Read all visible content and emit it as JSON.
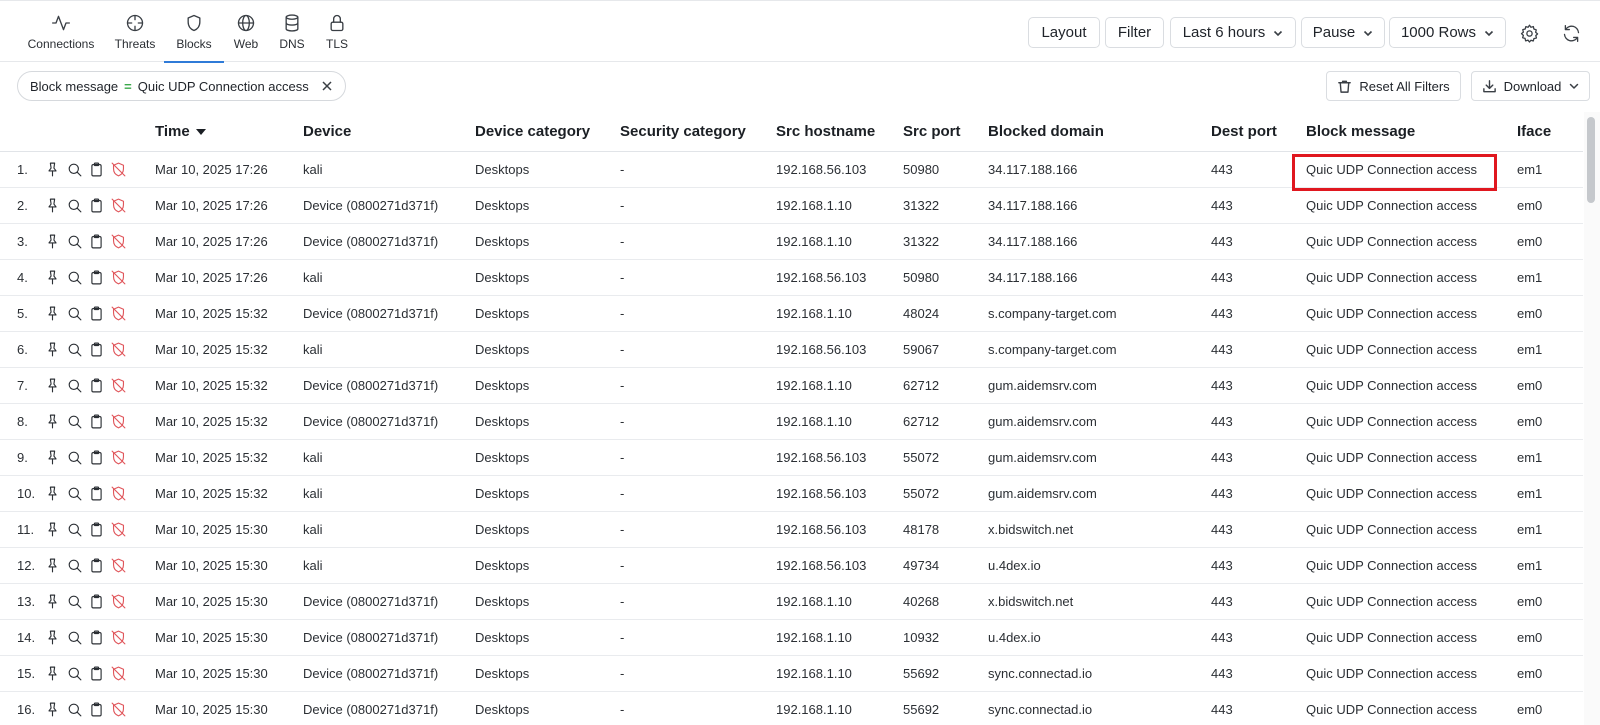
{
  "nav": {
    "tabs": [
      {
        "label": "Connections",
        "icon": "activity-icon"
      },
      {
        "label": "Threats",
        "icon": "crosshair-icon"
      },
      {
        "label": "Blocks",
        "icon": "shield-icon"
      },
      {
        "label": "Web",
        "icon": "globe-icon"
      },
      {
        "label": "DNS",
        "icon": "database-icon"
      },
      {
        "label": "TLS",
        "icon": "lock-icon"
      }
    ],
    "active_tab": "Blocks"
  },
  "toolbar": {
    "layout_label": "Layout",
    "filter_label": "Filter",
    "time_range": "Last 6 hours",
    "pause_label": "Pause",
    "rows_label": "1000 Rows"
  },
  "filters": {
    "chip": {
      "field": "Block message",
      "operator": "=",
      "value": "Quic UDP Connection access"
    },
    "reset_label": "Reset All Filters",
    "download_label": "Download"
  },
  "table": {
    "columns": [
      "Time",
      "Device",
      "Device category",
      "Security category",
      "Src hostname",
      "Src port",
      "Blocked domain",
      "Dest port",
      "Block message",
      "Iface"
    ],
    "sort_column": "Time",
    "sort_direction": "desc",
    "rows": [
      {
        "idx": "1.",
        "time": "Mar 10, 2025 17:26",
        "device": "kali",
        "device_category": "Desktops",
        "security_category": "-",
        "src_hostname": "192.168.56.103",
        "src_port": "50980",
        "blocked_domain": "34.117.188.166",
        "dest_port": "443",
        "block_message": "Quic UDP Connection access",
        "iface": "em1"
      },
      {
        "idx": "2.",
        "time": "Mar 10, 2025 17:26",
        "device": "Device (0800271d371f)",
        "device_category": "Desktops",
        "security_category": "-",
        "src_hostname": "192.168.1.10",
        "src_port": "31322",
        "blocked_domain": "34.117.188.166",
        "dest_port": "443",
        "block_message": "Quic UDP Connection access",
        "iface": "em0"
      },
      {
        "idx": "3.",
        "time": "Mar 10, 2025 17:26",
        "device": "Device (0800271d371f)",
        "device_category": "Desktops",
        "security_category": "-",
        "src_hostname": "192.168.1.10",
        "src_port": "31322",
        "blocked_domain": "34.117.188.166",
        "dest_port": "443",
        "block_message": "Quic UDP Connection access",
        "iface": "em0"
      },
      {
        "idx": "4.",
        "time": "Mar 10, 2025 17:26",
        "device": "kali",
        "device_category": "Desktops",
        "security_category": "-",
        "src_hostname": "192.168.56.103",
        "src_port": "50980",
        "blocked_domain": "34.117.188.166",
        "dest_port": "443",
        "block_message": "Quic UDP Connection access",
        "iface": "em1"
      },
      {
        "idx": "5.",
        "time": "Mar 10, 2025 15:32",
        "device": "Device (0800271d371f)",
        "device_category": "Desktops",
        "security_category": "-",
        "src_hostname": "192.168.1.10",
        "src_port": "48024",
        "blocked_domain": "s.company-target.com",
        "dest_port": "443",
        "block_message": "Quic UDP Connection access",
        "iface": "em0"
      },
      {
        "idx": "6.",
        "time": "Mar 10, 2025 15:32",
        "device": "kali",
        "device_category": "Desktops",
        "security_category": "-",
        "src_hostname": "192.168.56.103",
        "src_port": "59067",
        "blocked_domain": "s.company-target.com",
        "dest_port": "443",
        "block_message": "Quic UDP Connection access",
        "iface": "em1"
      },
      {
        "idx": "7.",
        "time": "Mar 10, 2025 15:32",
        "device": "Device (0800271d371f)",
        "device_category": "Desktops",
        "security_category": "-",
        "src_hostname": "192.168.1.10",
        "src_port": "62712",
        "blocked_domain": "gum.aidemsrv.com",
        "dest_port": "443",
        "block_message": "Quic UDP Connection access",
        "iface": "em0"
      },
      {
        "idx": "8.",
        "time": "Mar 10, 2025 15:32",
        "device": "Device (0800271d371f)",
        "device_category": "Desktops",
        "security_category": "-",
        "src_hostname": "192.168.1.10",
        "src_port": "62712",
        "blocked_domain": "gum.aidemsrv.com",
        "dest_port": "443",
        "block_message": "Quic UDP Connection access",
        "iface": "em0"
      },
      {
        "idx": "9.",
        "time": "Mar 10, 2025 15:32",
        "device": "kali",
        "device_category": "Desktops",
        "security_category": "-",
        "src_hostname": "192.168.56.103",
        "src_port": "55072",
        "blocked_domain": "gum.aidemsrv.com",
        "dest_port": "443",
        "block_message": "Quic UDP Connection access",
        "iface": "em1"
      },
      {
        "idx": "10.",
        "time": "Mar 10, 2025 15:32",
        "device": "kali",
        "device_category": "Desktops",
        "security_category": "-",
        "src_hostname": "192.168.56.103",
        "src_port": "55072",
        "blocked_domain": "gum.aidemsrv.com",
        "dest_port": "443",
        "block_message": "Quic UDP Connection access",
        "iface": "em1"
      },
      {
        "idx": "11.",
        "time": "Mar 10, 2025 15:30",
        "device": "kali",
        "device_category": "Desktops",
        "security_category": "-",
        "src_hostname": "192.168.56.103",
        "src_port": "48178",
        "blocked_domain": "x.bidswitch.net",
        "dest_port": "443",
        "block_message": "Quic UDP Connection access",
        "iface": "em1"
      },
      {
        "idx": "12.",
        "time": "Mar 10, 2025 15:30",
        "device": "kali",
        "device_category": "Desktops",
        "security_category": "-",
        "src_hostname": "192.168.56.103",
        "src_port": "49734",
        "blocked_domain": "u.4dex.io",
        "dest_port": "443",
        "block_message": "Quic UDP Connection access",
        "iface": "em1"
      },
      {
        "idx": "13.",
        "time": "Mar 10, 2025 15:30",
        "device": "Device (0800271d371f)",
        "device_category": "Desktops",
        "security_category": "-",
        "src_hostname": "192.168.1.10",
        "src_port": "40268",
        "blocked_domain": "x.bidswitch.net",
        "dest_port": "443",
        "block_message": "Quic UDP Connection access",
        "iface": "em0"
      },
      {
        "idx": "14.",
        "time": "Mar 10, 2025 15:30",
        "device": "Device (0800271d371f)",
        "device_category": "Desktops",
        "security_category": "-",
        "src_hostname": "192.168.1.10",
        "src_port": "10932",
        "blocked_domain": "u.4dex.io",
        "dest_port": "443",
        "block_message": "Quic UDP Connection access",
        "iface": "em0"
      },
      {
        "idx": "15.",
        "time": "Mar 10, 2025 15:30",
        "device": "Device (0800271d371f)",
        "device_category": "Desktops",
        "security_category": "-",
        "src_hostname": "192.168.1.10",
        "src_port": "55692",
        "blocked_domain": "sync.connectad.io",
        "dest_port": "443",
        "block_message": "Quic UDP Connection access",
        "iface": "em0"
      },
      {
        "idx": "16.",
        "time": "Mar 10, 2025 15:30",
        "device": "Device (0800271d371f)",
        "device_category": "Desktops",
        "security_category": "-",
        "src_hostname": "192.168.1.10",
        "src_port": "55692",
        "blocked_domain": "sync.connectad.io",
        "dest_port": "443",
        "block_message": "Quic UDP Connection access",
        "iface": "em0"
      }
    ],
    "row_actions": [
      "pin-icon",
      "search-icon",
      "clipboard-icon",
      "shield-off-icon"
    ]
  },
  "colors": {
    "accent": "#2f7bd8",
    "highlight_box": "#e0171f",
    "block_icon": "#e0565b",
    "filter_operator": "#3aa84a"
  }
}
